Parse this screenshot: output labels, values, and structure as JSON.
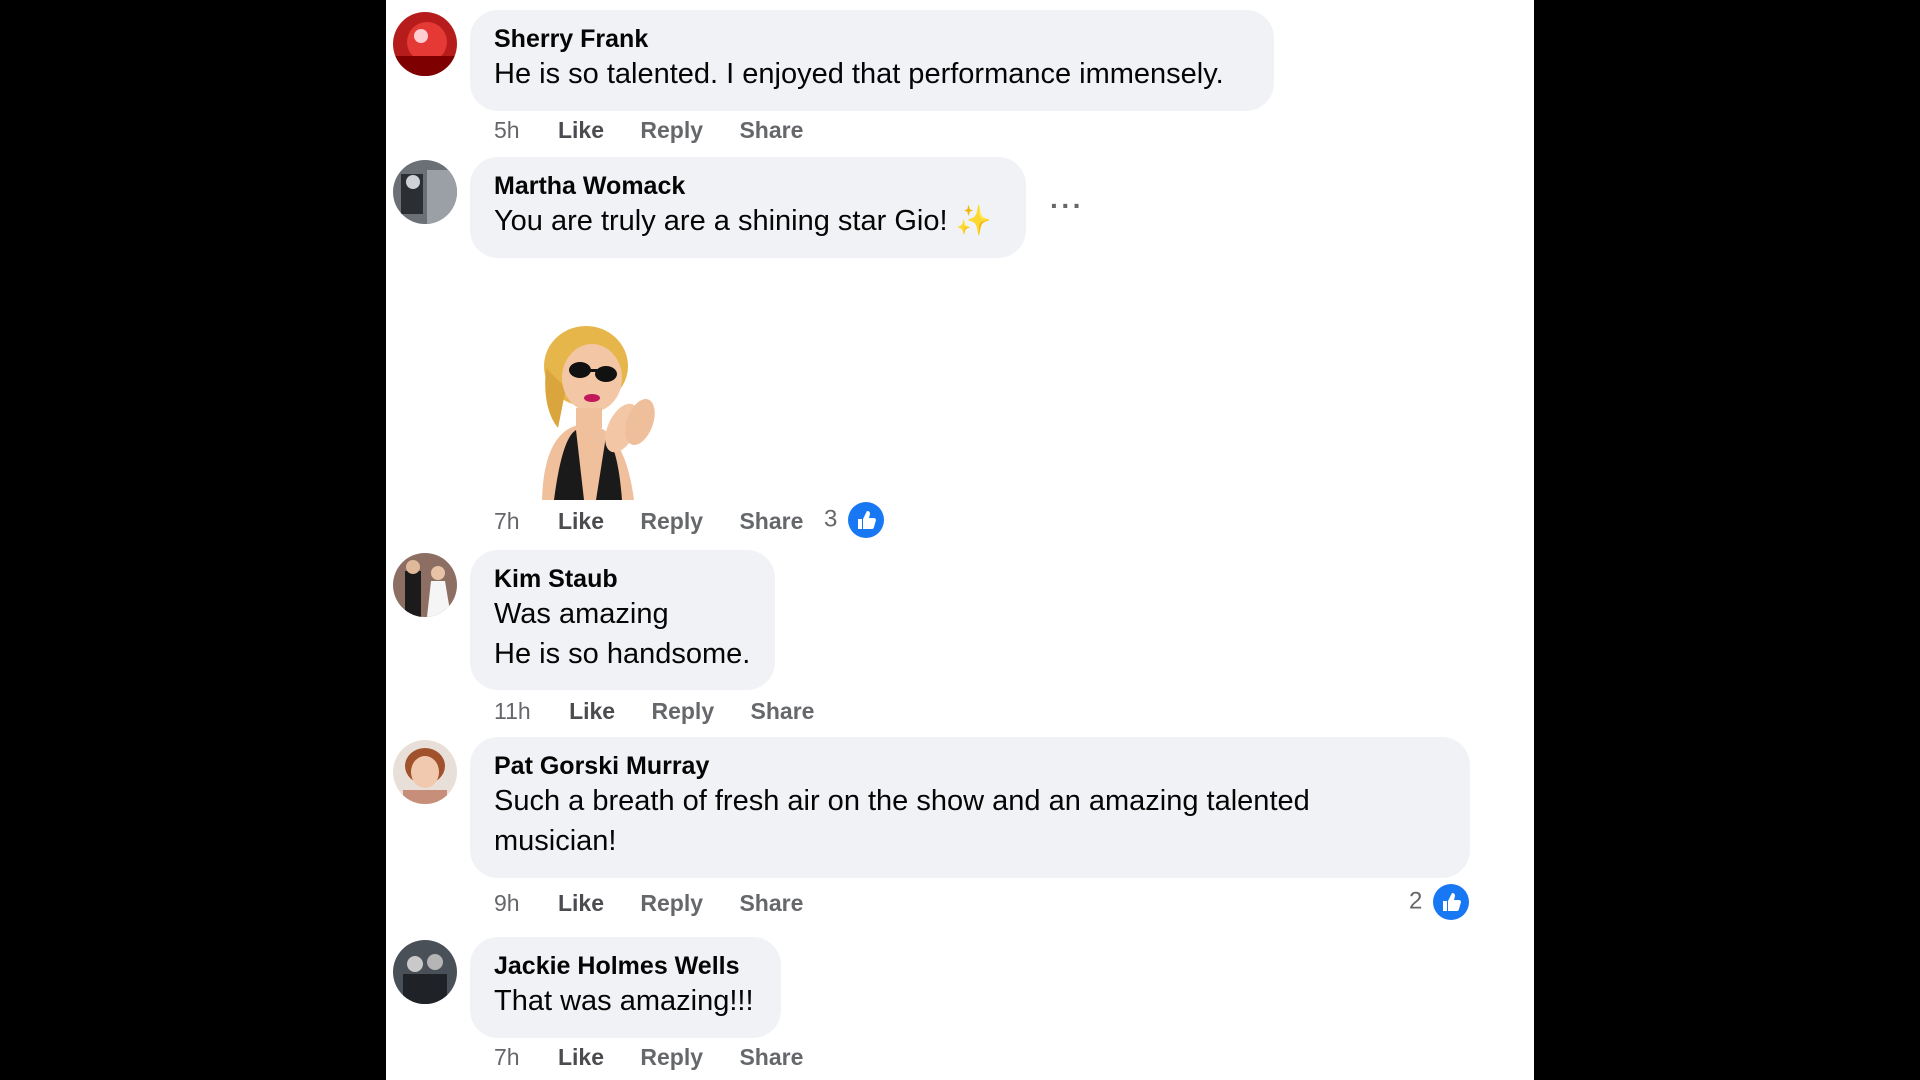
{
  "comments": [
    {
      "author": "Sherry Frank",
      "lines": [
        "He is so talented. I enjoyed that performance immensely."
      ],
      "time": "5h",
      "like": "Like",
      "reply": "Reply",
      "share": "Share",
      "avatar_color": "#c62828"
    },
    {
      "author": "Martha Womack",
      "lines": [
        "You are truly are a shining star Gio! ✨"
      ],
      "time": "7h",
      "like": "Like",
      "reply": "Reply",
      "share": "Share",
      "reaction_count": "3",
      "has_sticker": true,
      "more_label": "···",
      "avatar_color": "#555a60"
    },
    {
      "author": "Kim Staub",
      "lines": [
        "Was amazing",
        "He is so handsome."
      ],
      "time": "11h",
      "like": "Like",
      "reply": "Reply",
      "share": "Share",
      "avatar_color": "#6d4c41"
    },
    {
      "author": "Pat Gorski Murray",
      "lines": [
        "Such a breath of fresh air on the show and an amazing talented",
        "musician!"
      ],
      "time": "9h",
      "like": "Like",
      "reply": "Reply",
      "share": "Share",
      "reaction_count": "2",
      "avatar_color": "#b08070"
    },
    {
      "author": "Jackie Holmes Wells",
      "lines": [
        "That was amazing!!!"
      ],
      "time": "7h",
      "like": "Like",
      "reply": "Reply",
      "share": "Share",
      "avatar_color": "#3a3f45"
    }
  ],
  "colors": {
    "bubble": "#f0f2f5",
    "reaction_blue": "#1877f2",
    "meta_gray": "#65676b"
  },
  "icons": {
    "reaction": "thumbs-up-icon",
    "more": "more-options-icon"
  }
}
